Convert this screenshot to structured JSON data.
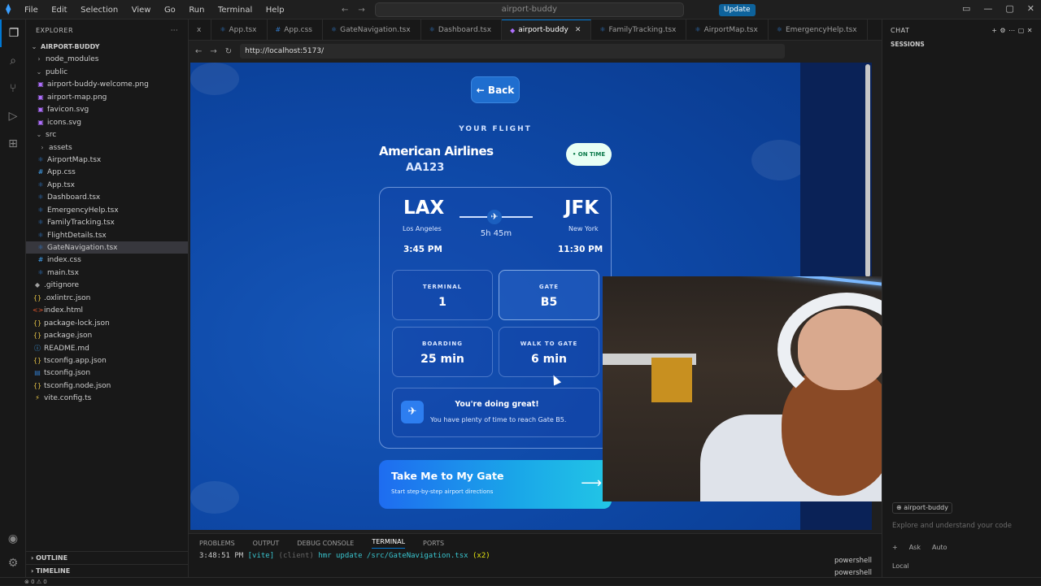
{
  "titlebar": {
    "menu": [
      "File",
      "Edit",
      "Selection",
      "View",
      "Go",
      "Run",
      "Terminal",
      "Help"
    ],
    "command_center": "airport-buddy",
    "update_label": "Update"
  },
  "explorer": {
    "header": "EXPLORER",
    "project": "AIRPORT-BUDDY",
    "tree": [
      {
        "label": "node_modules",
        "type": "folder"
      },
      {
        "label": "public",
        "type": "folder-open"
      },
      {
        "label": "airport-buddy-welcome.png",
        "type": "image"
      },
      {
        "label": "airport-map.png",
        "type": "image"
      },
      {
        "label": "favicon.svg",
        "type": "image"
      },
      {
        "label": "icons.svg",
        "type": "image"
      },
      {
        "label": "src",
        "type": "folder-open"
      },
      {
        "label": "assets",
        "type": "folder"
      },
      {
        "label": "AirportMap.tsx",
        "type": "ts"
      },
      {
        "label": "App.css",
        "type": "css"
      },
      {
        "label": "App.tsx",
        "type": "ts"
      },
      {
        "label": "Dashboard.tsx",
        "type": "ts"
      },
      {
        "label": "EmergencyHelp.tsx",
        "type": "ts"
      },
      {
        "label": "FamilyTracking.tsx",
        "type": "ts"
      },
      {
        "label": "FlightDetails.tsx",
        "type": "ts"
      },
      {
        "label": "GateNavigation.tsx",
        "type": "ts"
      },
      {
        "label": "index.css",
        "type": "css"
      },
      {
        "label": "main.tsx",
        "type": "ts"
      },
      {
        "label": ".gitignore",
        "type": "git"
      },
      {
        "label": ".oxlintrc.json",
        "type": "json"
      },
      {
        "label": "index.html",
        "type": "html"
      },
      {
        "label": "package-lock.json",
        "type": "json"
      },
      {
        "label": "package.json",
        "type": "json"
      },
      {
        "label": "README.md",
        "type": "md"
      },
      {
        "label": "tsconfig.app.json",
        "type": "json"
      },
      {
        "label": "tsconfig.json",
        "type": "tsjson"
      },
      {
        "label": "tsconfig.node.json",
        "type": "json"
      },
      {
        "label": "vite.config.ts",
        "type": "vite"
      }
    ],
    "outline": "OUTLINE",
    "timeline": "TIMELINE"
  },
  "tabs": [
    {
      "label": "x"
    },
    {
      "label": "App.tsx"
    },
    {
      "label": "App.css"
    },
    {
      "label": "GateNavigation.tsx"
    },
    {
      "label": "Dashboard.tsx"
    },
    {
      "label": "airport-buddy",
      "active": true
    },
    {
      "label": "FamilyTracking.tsx"
    },
    {
      "label": "AirportMap.tsx"
    },
    {
      "label": "EmergencyHelp.tsx"
    }
  ],
  "browser": {
    "url": "http://localhost:5173/"
  },
  "app": {
    "back_label": "← Back",
    "your_flight": "YOUR FLIGHT",
    "airline": "American Airlines",
    "flight_number": "AA123",
    "status": "• ON TIME",
    "origin": {
      "code": "LAX",
      "city": "Los Angeles",
      "time": "3:45 PM"
    },
    "destination": {
      "code": "JFK",
      "city": "New York",
      "time": "11:30 PM"
    },
    "duration": "5h 45m",
    "stats": [
      {
        "label": "TERMINAL",
        "value": "1"
      },
      {
        "label": "GATE",
        "value": "B5"
      },
      {
        "label": "BOARDING",
        "value": "25 min"
      },
      {
        "label": "WALK TO GATE",
        "value": "6 min"
      }
    ],
    "info_title": "You're doing great!",
    "info_sub": "You have plenty of time to reach Gate B5.",
    "cta_title": "Take Me to My Gate",
    "cta_sub": "Start step-by-step airport directions"
  },
  "chat": {
    "header": "CHAT",
    "sessions": "SESSIONS",
    "context_chip": "airport-buddy",
    "placeholder": "Explore and understand your code",
    "ask": "Ask",
    "auto": "Auto",
    "local": "Local"
  },
  "panel": {
    "tabs": [
      "PROBLEMS",
      "OUTPUT",
      "DEBUG CONSOLE",
      "TERMINAL",
      "PORTS"
    ],
    "active_tab": "TERMINAL",
    "term_time": "3:48:51 PM",
    "term_vite": "[vite]",
    "term_client": "(client)",
    "term_msg": "hmr update /src/GateNavigation.tsx",
    "term_count": "(x2)",
    "shells": [
      "powershell",
      "powershell"
    ]
  },
  "statusbar": {
    "problems": "⊗ 0 ⚠ 0"
  }
}
